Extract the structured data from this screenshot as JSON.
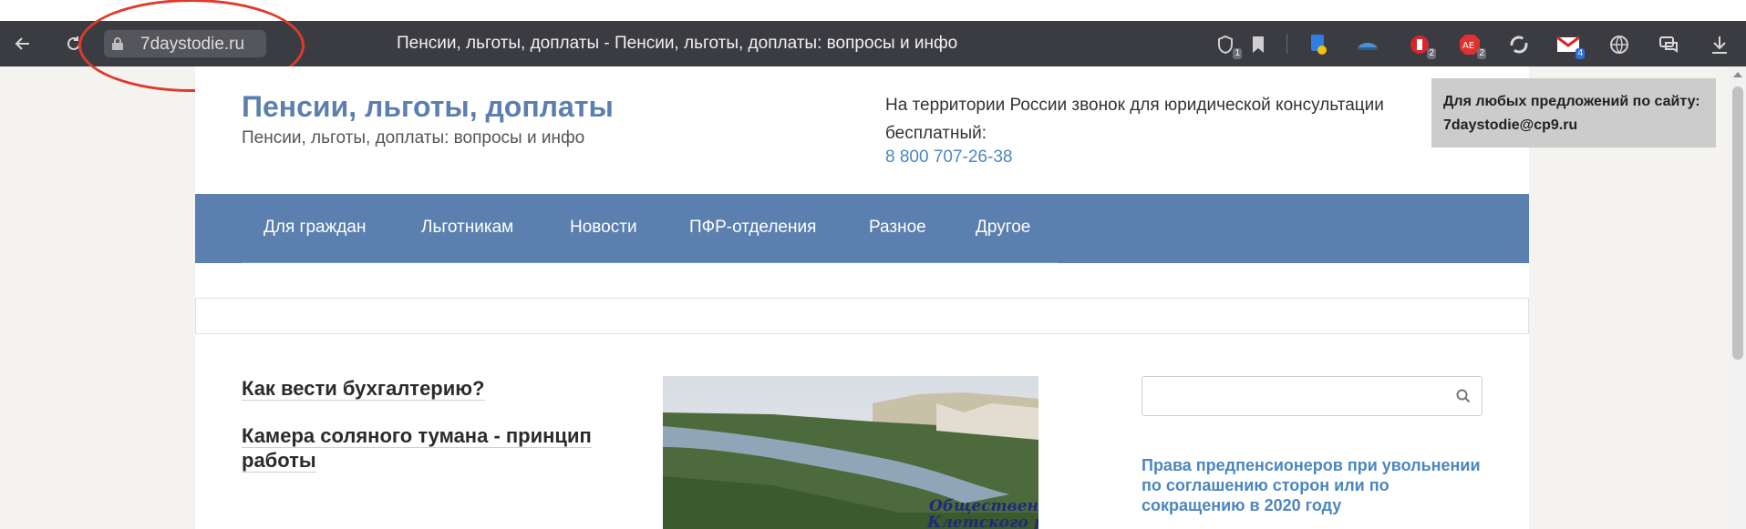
{
  "browser": {
    "url": "7daystodie.ru",
    "tab_title": "Пенсии, льготы, доплаты - Пенсии, льготы, доплаты: вопросы и инфо",
    "icons": [
      "back-icon",
      "reload-icon",
      "lock-icon",
      "shield-icon",
      "bookmark-icon",
      "page-download-icon",
      "vpn-icon",
      "extension-badge-icon",
      "adblock-icon",
      "sync-icon",
      "mail-icon",
      "globe-icon",
      "chat-icon",
      "download-icon"
    ],
    "badges": {
      "shield": "1",
      "ext1": "2",
      "adblock": "2",
      "mail": "4"
    }
  },
  "site": {
    "title": "Пенсии, льготы, доплаты",
    "subtitle": "Пенсии, льготы, доплаты: вопросы и инфо",
    "header_note": "На территории России звонок для юридической консультации бесплатный:",
    "phone": "8 800 707-26-38"
  },
  "nav": {
    "items": [
      "Для граждан",
      "Льготникам",
      "Новости",
      "ПФР-отделения",
      "Разное",
      "Другое"
    ]
  },
  "articles": [
    "Как вести бухгалтерию?",
    "Камера соляного тумана - принцип работы"
  ],
  "photo_caption": [
    "Общественно",
    "Клетского ра"
  ],
  "sidebar": {
    "search_placeholder": "",
    "link": "Права предпенсионеров при увольнении по соглашению сторон или по сокращению в 2020 году"
  },
  "ad": {
    "text": "Для любых предложений по сайту: 7daystodie@cp9.ru"
  },
  "colors": {
    "brand": "#5b7fae",
    "link": "#4b86c0",
    "annotation": "#e03a2c"
  }
}
